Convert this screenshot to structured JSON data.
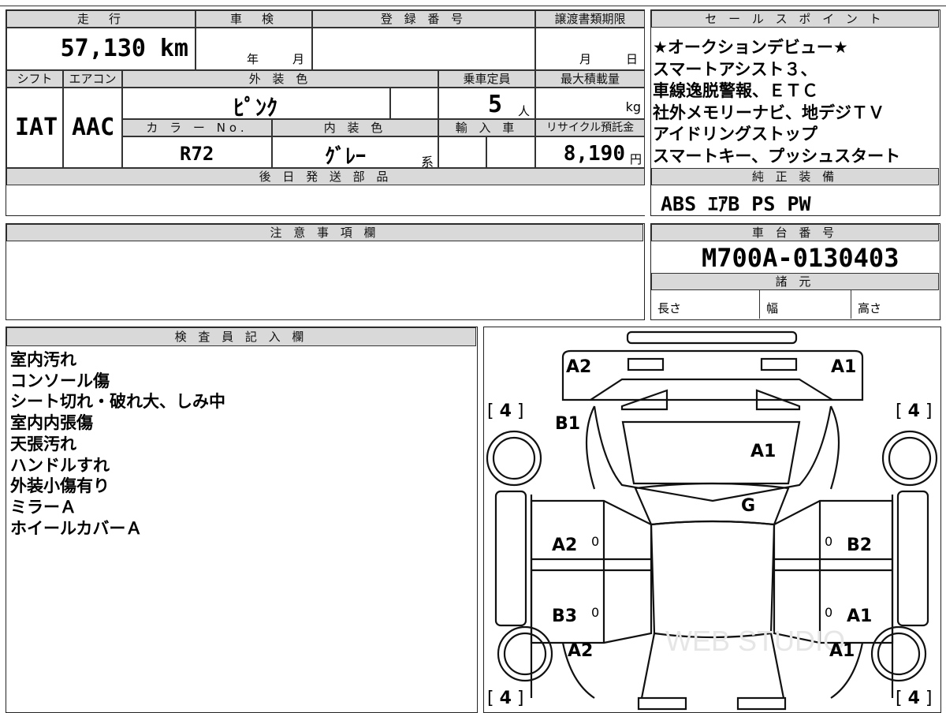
{
  "top": {
    "mileage_header": "走　行",
    "mileage": "57,130",
    "mileage_unit": "km",
    "shaken_header": "車　検",
    "shaken_year": "年",
    "shaken_month": "月",
    "reg_header": "登 録 番 号",
    "transfer_header": "譲渡書類期限",
    "transfer_month": "月",
    "transfer_day": "日",
    "shift_header": "シフト",
    "ac_header": "エアコン",
    "color_header": "外 装 色",
    "capacity_header": "乗車定員",
    "load_header": "最大積載量",
    "shift": "IAT",
    "ac": "AAC",
    "color": "ﾋﾟﾝｸ",
    "capacity": "5",
    "capacity_unit": "人",
    "load_unit": "kg",
    "colorno_header": "カ ラ ー No.",
    "interior_header": "内 装 色",
    "import_header": "輸 入 車",
    "recycle_header": "リサイクル預託金",
    "colorno": "R72",
    "interior": "ｸﾞﾚｰ",
    "interior_suffix": "系",
    "recycle": "8,190",
    "recycle_unit": "円",
    "later_parts_header": "後 日 発 送 部 品"
  },
  "sales": {
    "header": "セ ー ル ス ポ イ ン ト",
    "lines": [
      "★オークションデビュー★",
      "スマートアシスト３、",
      "車線逸脱警報、ＥＴＣ",
      "社外メモリーナビ、地デジＴＶ",
      "アイドリングストップ",
      "スマートキー、プッシュスタート"
    ],
    "equip_header": "純 正 装 備",
    "equip": "ABS ｴｱB PS PW"
  },
  "caution": {
    "header": "注 意 事 項 欄"
  },
  "chassis": {
    "header": "車 台 番 号",
    "number": "M700A-0130403",
    "spec_header": "諸 元",
    "length": "長さ",
    "width": "幅",
    "height": "高さ"
  },
  "inspector": {
    "header": "検 査 員 記 入 欄",
    "notes": [
      "室内汚れ",
      "コンソール傷",
      "シート切れ・破れ大、しみ中",
      "室内内張傷",
      "天張汚れ",
      "ハンドルすれ",
      "外装小傷有り",
      "ミラーＡ",
      "ホイールカバーＡ"
    ]
  },
  "diagram": {
    "front_left": "A2",
    "front_right": "A1",
    "hood_left": "B1",
    "windshield": "A1",
    "roof": "G",
    "door_fl": "A2",
    "door_fr": "B2",
    "door_rl": "B3",
    "door_rr": "A1",
    "rear_left": "A2",
    "rear_right": "A1",
    "tire_fl": "4",
    "tire_fr": "4",
    "tire_rl": "4",
    "tire_rr": "4",
    "zero1": "0",
    "zero2": "0",
    "zero3": "0",
    "zero4": "0",
    "watermark": "WEB STUDIO"
  }
}
